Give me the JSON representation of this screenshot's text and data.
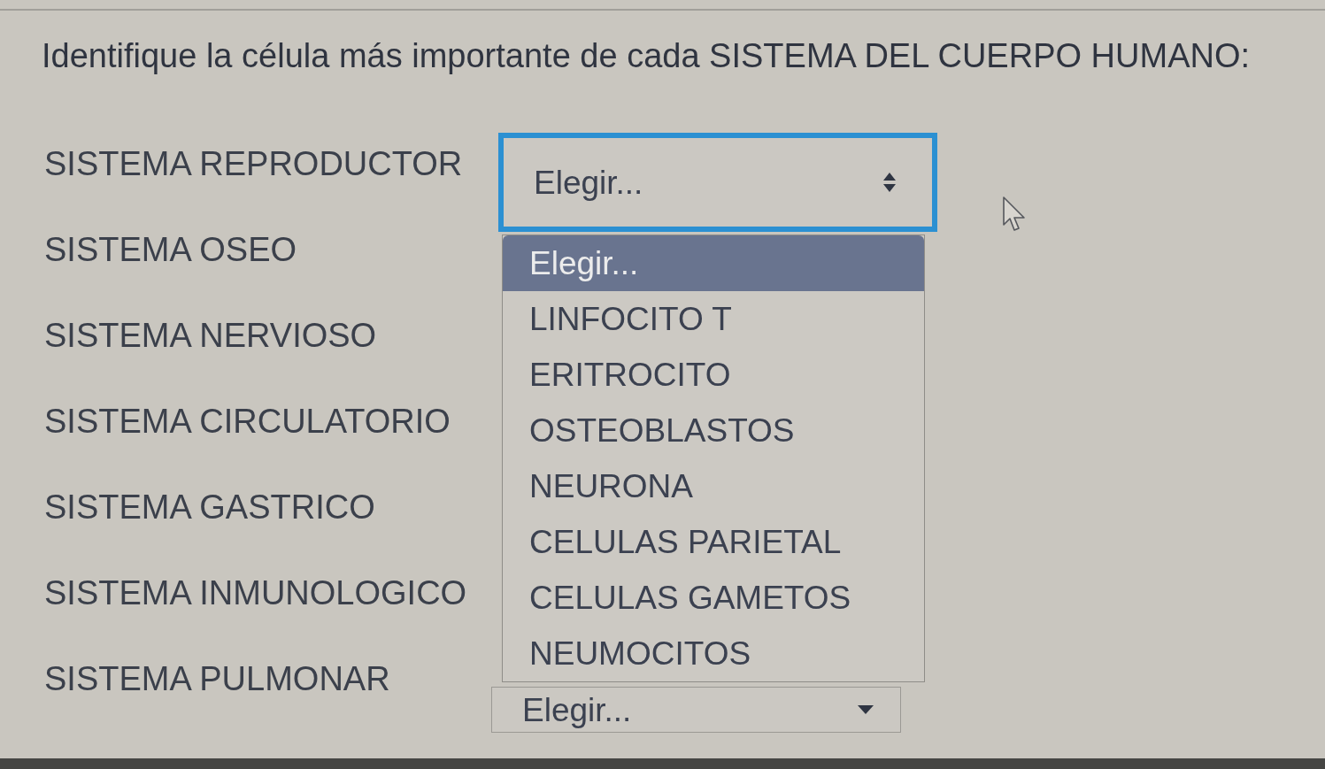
{
  "question": "Identifique la célula más importante de cada SISTEMA DEL CUERPO HUMANO:",
  "rows": [
    {
      "label": "SISTEMA REPRODUCTOR",
      "select": {
        "value": "Elegir...",
        "focused": true,
        "expanded": true,
        "options": [
          {
            "label": "Elegir...",
            "selected": true
          },
          {
            "label": "LINFOCITO T",
            "selected": false
          },
          {
            "label": "ERITROCITO",
            "selected": false
          },
          {
            "label": "OSTEOBLASTOS",
            "selected": false
          },
          {
            "label": "NEURONA",
            "selected": false
          },
          {
            "label": "CELULAS PARIETAL",
            "selected": false
          },
          {
            "label": "CELULAS GAMETOS",
            "selected": false
          },
          {
            "label": "NEUMOCITOS",
            "selected": false
          }
        ]
      }
    },
    {
      "label": "SISTEMA OSEO"
    },
    {
      "label": "SISTEMA NERVIOSO"
    },
    {
      "label": "SISTEMA CIRCULATORIO"
    },
    {
      "label": "SISTEMA GASTRICO"
    },
    {
      "label": "SISTEMA INMUNOLOGICO"
    },
    {
      "label": "SISTEMA PULMONAR",
      "select": {
        "value": "Elegir...",
        "focused": false,
        "expanded": false
      }
    }
  ]
}
